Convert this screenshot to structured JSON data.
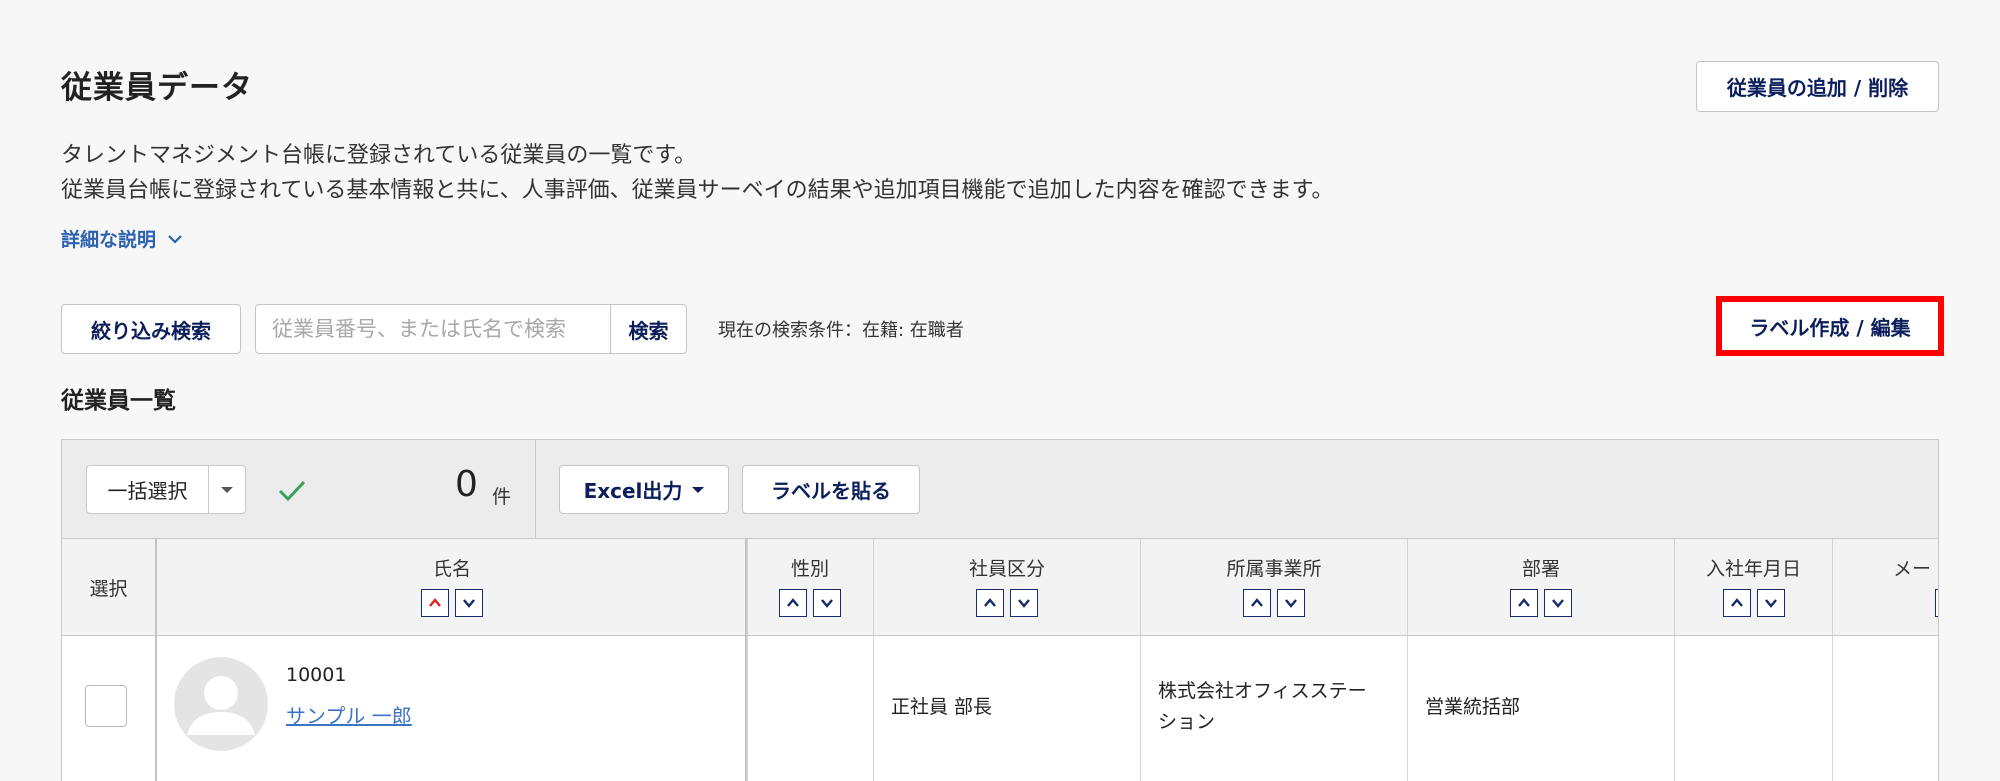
{
  "header": {
    "title": "従業員データ",
    "add_remove_button": "従業員の追加 / 削除",
    "description_line1": "タレントマネジメント台帳に登録されている従業員の一覧です。",
    "description_line2": "従業員台帳に登録されている基本情報と共に、人事評価、従業員サーベイの結果や追加項目機能で追加した内容を確認できます。",
    "detail_link": "詳細な説明"
  },
  "search": {
    "filter_button": "絞り込み検索",
    "placeholder": "従業員番号、または氏名で検索",
    "value": "",
    "search_button": "検索",
    "current_condition": "現在の検索条件：在籍: 在職者",
    "label_edit_button": "ラベル作成 / 編集"
  },
  "list": {
    "title": "従業員一覧",
    "bulk_select": "一括選択",
    "selected_count": "0",
    "count_unit": "件",
    "excel_button": "Excel出力",
    "paste_label_button": "ラベルを貼る",
    "columns": {
      "select": "選択",
      "name": "氏名",
      "gender": "性別",
      "employee_type": "社員区分",
      "office": "所属事業所",
      "department": "部署",
      "hire_date": "入社年月日",
      "mail": "メー"
    },
    "rows": [
      {
        "employee_id": "10001",
        "name": "サンプル 一郎",
        "gender": "",
        "employee_type": "正社員 部長",
        "office_line1": "株式会社オフィスステー",
        "office_line2": "ション",
        "department": "営業統括部",
        "hire_date": ""
      }
    ]
  },
  "colors": {
    "accent_navy": "#0c1e5b",
    "link_blue": "#3b73c8",
    "highlight_red": "#ff0000",
    "check_green": "#3aa05a",
    "sort_active_red": "#e02020"
  }
}
